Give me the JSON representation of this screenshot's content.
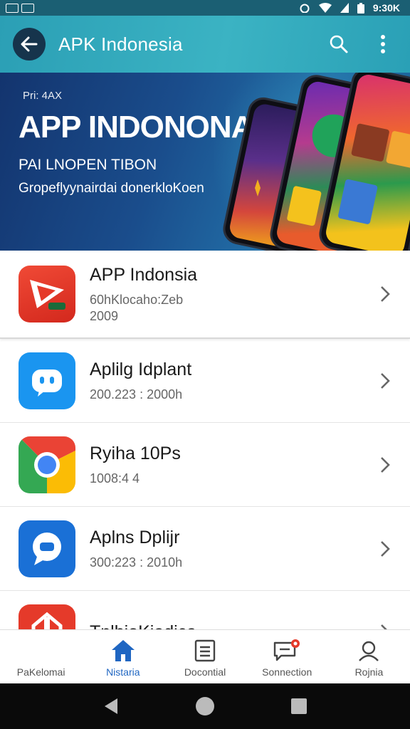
{
  "status_bar": {
    "time": "9:30K"
  },
  "app_bar": {
    "title": "APK Indonesia"
  },
  "banner": {
    "small": "Pri: 4AX",
    "title": "APP INDONONA",
    "subtitle": "PAI LNOPEN TIBON",
    "tagline": "Gropeflyynairdai donerkloKoen"
  },
  "apps": [
    {
      "name": "APP Indonsia",
      "meta": "60hKlocaho:Zeb",
      "meta2": "2009",
      "icon": "play-arrow-icon",
      "color": "#e53a2a"
    },
    {
      "name": "Aplilg Idplant",
      "meta": "200.223 : 2000h",
      "meta2": "",
      "icon": "chat-bot-icon",
      "color": "#1a95f0"
    },
    {
      "name": "Ryiha 10Ps",
      "meta": "1008:4 4",
      "meta2": "",
      "icon": "chrome-icon",
      "color": "#f2f2f2"
    },
    {
      "name": "Aplns Dplijr",
      "meta": "300:223 : 2010h",
      "meta2": "",
      "icon": "message-bubble-icon",
      "color": "#1a70d6"
    },
    {
      "name": "TnlbioKiadica",
      "meta": "",
      "meta2": "",
      "icon": "gift-icon",
      "color": "#e53a2a"
    }
  ],
  "bottom_nav": [
    {
      "label": "PaKelomai",
      "icon": "apps-icon"
    },
    {
      "label": "Nistaria",
      "icon": "home-icon"
    },
    {
      "label": "Docontial",
      "icon": "document-icon"
    },
    {
      "label": "Sonnection",
      "icon": "chat-notification-icon"
    },
    {
      "label": "Rojnia",
      "icon": "profile-icon"
    }
  ],
  "colors": {
    "app_bar": "#2ba2b8",
    "banner": "#13346e",
    "accent": "#1f66c2"
  }
}
